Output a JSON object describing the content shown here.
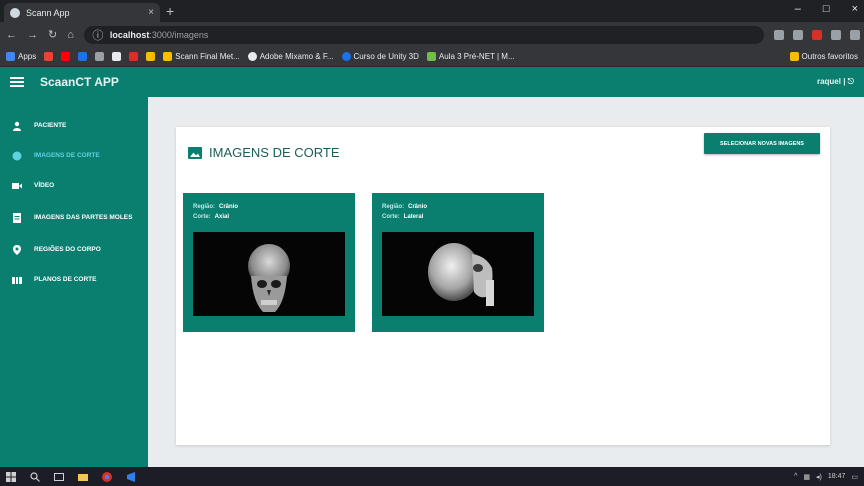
{
  "browser": {
    "tab_title": "Scann App",
    "tab_close": "×",
    "new_tab": "+",
    "window_controls": [
      "–",
      "□",
      "×"
    ],
    "url_host": "localhost",
    "url_path": ":3000/imagens",
    "bookmarks": [
      "Apps",
      "Scann Final Met...",
      "Adobe Mixamo & F...",
      "Curso de Unity 3D",
      "Aula 3 Pré-NET | M...",
      "Outros favoritos"
    ]
  },
  "header": {
    "app_title": "ScaanCT APP",
    "user": "raquel | ⎋"
  },
  "sidebar": {
    "items": [
      {
        "label": "Paciente"
      },
      {
        "label": "Imagens de corte"
      },
      {
        "label": "Vídeo"
      },
      {
        "label": "Imagens das partes moles"
      },
      {
        "label": "Regiões do corpo"
      },
      {
        "label": "Planos de corte"
      }
    ]
  },
  "main": {
    "title": "IMAGENS DE CORTE",
    "action_button": "Selecionar novas imagens",
    "cards": [
      {
        "region_key": "Região:",
        "region_value": "Crânio",
        "plane_key": "Corte:",
        "plane_value": "Axial"
      },
      {
        "region_key": "Região:",
        "region_value": "Crânio",
        "plane_key": "Corte:",
        "plane_value": "Lateral"
      }
    ]
  },
  "taskbar": {
    "clock": "18:47"
  },
  "colors": {
    "accent": "#0a7f70",
    "active_nav": "#5fd2e0",
    "content_bg": "#e9ecee"
  }
}
